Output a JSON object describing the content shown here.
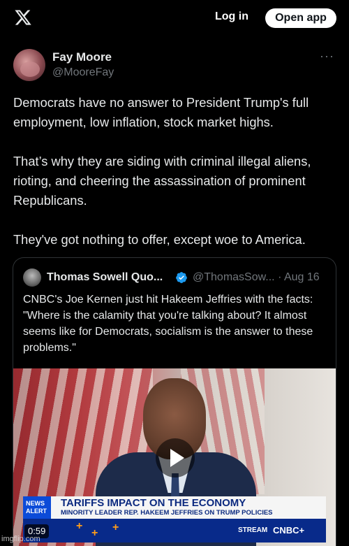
{
  "header": {
    "logo_icon": "x-logo-icon",
    "login_label": "Log in",
    "open_app_label": "Open app"
  },
  "post": {
    "author_name": "Fay Moore",
    "author_handle": "@MooreFay",
    "more_icon": "more-horizontal-icon",
    "paragraphs": [
      "Democrats have no answer to President Trump's full employment, low inflation, stock market highs.",
      "That’s why they are siding with criminal illegal aliens, rioting, and cheering the assassination of prominent Republicans.",
      "They've got nothing to offer, except woe to America."
    ]
  },
  "quoted_post": {
    "author_name": "Thomas Sowell Quo...",
    "verified_icon": "verified-badge-icon",
    "handle_and_date": "@ThomasSow... · Aug 16",
    "text": "CNBC's Joe Kernen just hit Hakeem Jeffries with the facts: \"Where is the calamity that you're talking about? It almost seems like for Democrats, socialism is the answer to these problems.\"",
    "video": {
      "play_icon": "play-icon",
      "news_alert": "NEWS ALERT",
      "headline": "TARIFFS IMPACT ON THE ECONOMY",
      "subline": "MINORITY LEADER REP. HAKEEM JEFFRIES ON TRUMP POLICIES",
      "stream_label": "STREAM",
      "network_label": "CNBC+",
      "duration": "0:59"
    }
  },
  "watermark": "imgflip.com",
  "colors": {
    "background": "#000000",
    "text": "#e7e9ea",
    "secondary_text": "#71767b",
    "verified": "#1d9bf0",
    "border": "#2f3336"
  }
}
